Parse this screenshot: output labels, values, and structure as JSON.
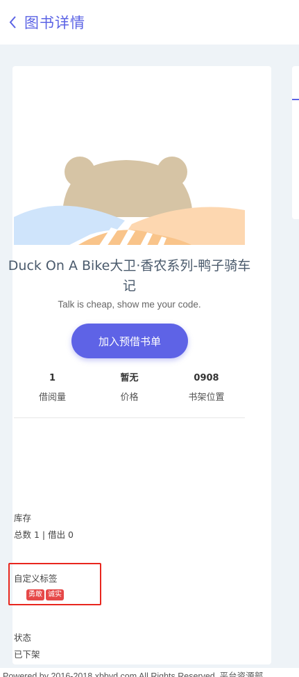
{
  "header": {
    "title": "图书详情",
    "back_icon": "chevron-left-icon"
  },
  "book": {
    "title": "Duck On A Bike大卫·香农系列-鸭子骑车记",
    "subtitle": "Talk is cheap, show me your code.",
    "reserve_label": "加入预借书单"
  },
  "stats": [
    {
      "value": "1",
      "label": "借阅量"
    },
    {
      "value": "暂无",
      "label": "价格"
    },
    {
      "value": "0908",
      "label": "书架位置"
    }
  ],
  "inventory": {
    "label": "库存",
    "value": "总数 1 | 借出 0"
  },
  "custom_tags": {
    "label": "自定义标签",
    "tags": [
      "勇敢",
      "诚实"
    ]
  },
  "status": {
    "label": "状态",
    "value": "已下架"
  },
  "footer": {
    "text": "Powered by 2016-2018 xbbyd.com All Rights Reserved. 平台资源部"
  },
  "colors": {
    "accent": "#5e63e6",
    "tag": "#e64848",
    "highlight_border": "#e8261e"
  }
}
